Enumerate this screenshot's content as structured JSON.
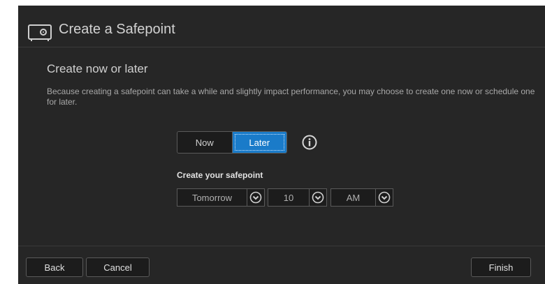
{
  "dialog": {
    "title": "Create a Safepoint",
    "icon": "safe-icon"
  },
  "section": {
    "title": "Create now or later",
    "description": "Because creating a safepoint can take a while and slightly impact performance, you may choose to create one now or schedule one for later."
  },
  "mode_toggle": {
    "now_label": "Now",
    "later_label": "Later",
    "selected": "Later",
    "info_icon": "info-icon"
  },
  "schedule": {
    "label": "Create your safepoint",
    "day": "Tomorrow",
    "hour": "10",
    "ampm": "AM",
    "dropdown_icon": "chevron-down-circle-icon"
  },
  "footer": {
    "back_label": "Back",
    "cancel_label": "Cancel",
    "finish_label": "Finish"
  },
  "colors": {
    "background": "#262626",
    "accent": "#1a7bc9",
    "button_bg": "#1c1c1c",
    "border": "#5a5a5a"
  }
}
